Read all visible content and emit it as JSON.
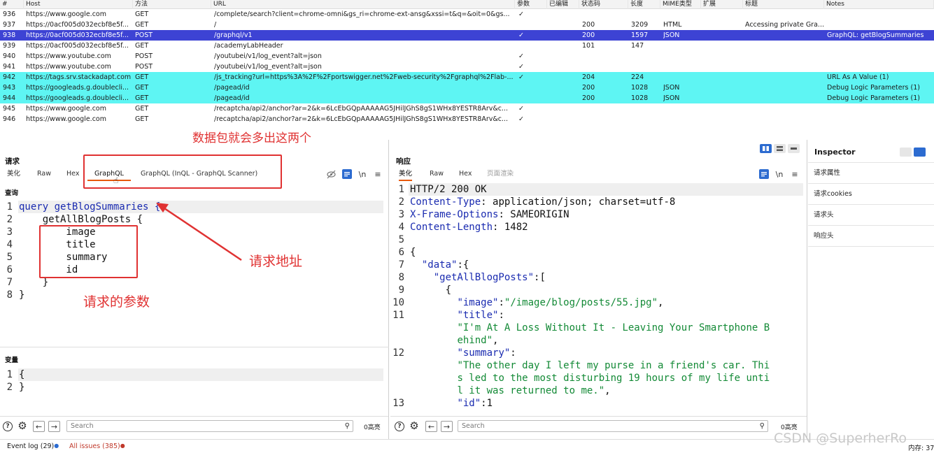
{
  "history": {
    "columns": [
      "#",
      "Host",
      "方法",
      "URL",
      "参数",
      "已编辑",
      "状态码",
      "长度",
      "MIME类型",
      "扩展",
      "标题",
      "Notes"
    ],
    "rows": [
      {
        "id": "936",
        "host": "https://www.google.com",
        "method": "GET",
        "url": "/complete/search?client=chrome-omni&gs_ri=chrome-ext-ansg&xssi=t&q=&oit=0&gs...",
        "params": "✓",
        "edited": "",
        "status": "",
        "length": "",
        "mime": "",
        "ext": "",
        "title": "",
        "notes": "",
        "style": ""
      },
      {
        "id": "937",
        "host": "https://0acf005d032ecbf8e5f...",
        "method": "GET",
        "url": "/",
        "params": "",
        "edited": "",
        "status": "200",
        "length": "3209",
        "mime": "HTML",
        "ext": "",
        "title": "Accessing private Gra...",
        "notes": "",
        "style": ""
      },
      {
        "id": "938",
        "host": "https://0acf005d032ecbf8e5f...",
        "method": "POST",
        "url": "/graphql/v1",
        "params": "✓",
        "edited": "",
        "status": "200",
        "length": "1597",
        "mime": "JSON",
        "ext": "",
        "title": "",
        "notes": "GraphQL: getBlogSummaries",
        "style": "sel"
      },
      {
        "id": "939",
        "host": "https://0acf005d032ecbf8e5f...",
        "method": "GET",
        "url": "/academyLabHeader",
        "params": "",
        "edited": "",
        "status": "101",
        "length": "147",
        "mime": "",
        "ext": "",
        "title": "",
        "notes": "",
        "style": ""
      },
      {
        "id": "940",
        "host": "https://www.youtube.com",
        "method": "POST",
        "url": "/youtubei/v1/log_event?alt=json",
        "params": "✓",
        "edited": "",
        "status": "",
        "length": "",
        "mime": "",
        "ext": "",
        "title": "",
        "notes": "",
        "style": ""
      },
      {
        "id": "941",
        "host": "https://www.youtube.com",
        "method": "POST",
        "url": "/youtubei/v1/log_event?alt=json",
        "params": "✓",
        "edited": "",
        "status": "",
        "length": "",
        "mime": "",
        "ext": "",
        "title": "",
        "notes": "",
        "style": ""
      },
      {
        "id": "942",
        "host": "https://tags.srv.stackadapt.com",
        "method": "GET",
        "url": "/js_tracking?url=https%3A%2F%2Fportswigger.net%2Fweb-security%2Fgraphql%2Flab-...",
        "params": "✓",
        "edited": "",
        "status": "204",
        "length": "224",
        "mime": "",
        "ext": "",
        "title": "",
        "notes": "URL As A Value (1)",
        "style": "cyan"
      },
      {
        "id": "943",
        "host": "https://googleads.g.doublecli...",
        "method": "GET",
        "url": "/pagead/id",
        "params": "",
        "edited": "",
        "status": "200",
        "length": "1028",
        "mime": "JSON",
        "ext": "",
        "title": "",
        "notes": "Debug Logic Parameters (1)",
        "style": "cyan"
      },
      {
        "id": "944",
        "host": "https://googleads.g.doublecli...",
        "method": "GET",
        "url": "/pagead/id",
        "params": "",
        "edited": "",
        "status": "200",
        "length": "1028",
        "mime": "JSON",
        "ext": "",
        "title": "",
        "notes": "Debug Logic Parameters (1)",
        "style": "cyan"
      },
      {
        "id": "945",
        "host": "https://www.google.com",
        "method": "GET",
        "url": "/recaptcha/api2/anchor?ar=2&k=6LcEbGQpAAAAAG5JHilJGhS8gS1WHx8YESTR8Arv&c...",
        "params": "✓",
        "edited": "",
        "status": "",
        "length": "",
        "mime": "",
        "ext": "",
        "title": "",
        "notes": "",
        "style": ""
      },
      {
        "id": "946",
        "host": "https://www.google.com",
        "method": "GET",
        "url": "/recaptcha/api2/anchor?ar=2&k=6LcEbGQpAAAAAG5JHilJGhS8gS1WHx8YESTR8Arv&c...",
        "params": "✓",
        "edited": "",
        "status": "",
        "length": "",
        "mime": "",
        "ext": "",
        "title": "",
        "notes": "",
        "style": ""
      }
    ]
  },
  "request": {
    "title": "请求",
    "tabs": [
      "美化",
      "Raw",
      "Hex",
      "GraphQL",
      "GraphQL (InQL - GraphQL Scanner)"
    ],
    "newline_label": "\\n",
    "query_label": "查询",
    "query_lines": [
      [
        {
          "t": "query getBlogSummaries {",
          "c": "kw"
        }
      ],
      [
        {
          "t": "    getAllBlogPosts {",
          "c": ""
        }
      ],
      [
        {
          "t": "        image",
          "c": ""
        }
      ],
      [
        {
          "t": "        title",
          "c": ""
        }
      ],
      [
        {
          "t": "        summary",
          "c": ""
        }
      ],
      [
        {
          "t": "        id",
          "c": ""
        }
      ],
      [
        {
          "t": "    }",
          "c": ""
        }
      ],
      [
        {
          "t": "}",
          "c": ""
        }
      ]
    ],
    "vars_label": "变量",
    "var_lines": [
      "{",
      "}"
    ],
    "search_placeholder": "Search",
    "highlight_count": "0高亮"
  },
  "response": {
    "title": "响应",
    "tabs": [
      "美化",
      "Raw",
      "Hex",
      "页面渲染"
    ],
    "newline_label": "\\n",
    "lines": [
      {
        "n": "1",
        "segs": [
          {
            "t": "HTTP/2 200 OK",
            "c": ""
          }
        ]
      },
      {
        "n": "2",
        "segs": [
          {
            "t": "Content-Type",
            "c": "key"
          },
          {
            "t": ": application/json; charset=utf-8",
            "c": ""
          }
        ]
      },
      {
        "n": "3",
        "segs": [
          {
            "t": "X-Frame-Options",
            "c": "key"
          },
          {
            "t": ": SAMEORIGIN",
            "c": ""
          }
        ]
      },
      {
        "n": "4",
        "segs": [
          {
            "t": "Content-Length",
            "c": "key"
          },
          {
            "t": ": 1482",
            "c": ""
          }
        ]
      },
      {
        "n": "5",
        "segs": [
          {
            "t": "",
            "c": ""
          }
        ]
      },
      {
        "n": "6",
        "segs": [
          {
            "t": "{",
            "c": ""
          }
        ]
      },
      {
        "n": "7",
        "segs": [
          {
            "t": "  ",
            "c": ""
          },
          {
            "t": "\"data\"",
            "c": "key"
          },
          {
            "t": ":{",
            "c": ""
          }
        ]
      },
      {
        "n": "8",
        "segs": [
          {
            "t": "    ",
            "c": ""
          },
          {
            "t": "\"getAllBlogPosts\"",
            "c": "key"
          },
          {
            "t": ":[",
            "c": ""
          }
        ]
      },
      {
        "n": "9",
        "segs": [
          {
            "t": "      {",
            "c": ""
          }
        ]
      },
      {
        "n": "10",
        "segs": [
          {
            "t": "        ",
            "c": ""
          },
          {
            "t": "\"image\"",
            "c": "key"
          },
          {
            "t": ":",
            "c": ""
          },
          {
            "t": "\"/image/blog/posts/55.jpg\"",
            "c": "str"
          },
          {
            "t": ",",
            "c": ""
          }
        ]
      },
      {
        "n": "11",
        "segs": [
          {
            "t": "        ",
            "c": ""
          },
          {
            "t": "\"title\"",
            "c": "key"
          },
          {
            "t": ":",
            "c": ""
          }
        ]
      },
      {
        "n": "",
        "segs": [
          {
            "t": "        ",
            "c": ""
          },
          {
            "t": "\"I'm At A Loss Without It - Leaving Your Smartphone B",
            "c": "str"
          }
        ]
      },
      {
        "n": "",
        "segs": [
          {
            "t": "        ",
            "c": ""
          },
          {
            "t": "ehind\"",
            "c": "str"
          },
          {
            "t": ",",
            "c": ""
          }
        ]
      },
      {
        "n": "12",
        "segs": [
          {
            "t": "        ",
            "c": ""
          },
          {
            "t": "\"summary\"",
            "c": "key"
          },
          {
            "t": ":",
            "c": ""
          }
        ]
      },
      {
        "n": "",
        "segs": [
          {
            "t": "        ",
            "c": ""
          },
          {
            "t": "\"The other day I left my purse in a friend's car. Thi",
            "c": "str"
          }
        ]
      },
      {
        "n": "",
        "segs": [
          {
            "t": "        ",
            "c": ""
          },
          {
            "t": "s led to the most disturbing 19 hours of my life unti",
            "c": "str"
          }
        ]
      },
      {
        "n": "",
        "segs": [
          {
            "t": "        ",
            "c": ""
          },
          {
            "t": "l it was returned to me.\"",
            "c": "str"
          },
          {
            "t": ",",
            "c": ""
          }
        ]
      },
      {
        "n": "13",
        "segs": [
          {
            "t": "        ",
            "c": ""
          },
          {
            "t": "\"id\"",
            "c": "key"
          },
          {
            "t": ":1",
            "c": ""
          }
        ]
      }
    ],
    "search_placeholder": "Search",
    "highlight_count": "0高亮"
  },
  "inspector": {
    "title": "Inspector",
    "items": [
      "请求属性",
      "请求cookies",
      "请求头",
      "响应头"
    ]
  },
  "status": {
    "event_log": "Event log (29)",
    "issues": "All issues (385)",
    "memory": "内存: 37",
    "watermark": "CSDN @SuperherRo"
  },
  "annotations": {
    "packets": "数据包就会多出这两个",
    "address": "请求地址",
    "params": "请求的参数"
  },
  "colors": {
    "selected_row": "#3d43d4",
    "highlight_row": "#5ef5f3",
    "annotation": "#e03232",
    "active_tab": "#e8590c"
  }
}
